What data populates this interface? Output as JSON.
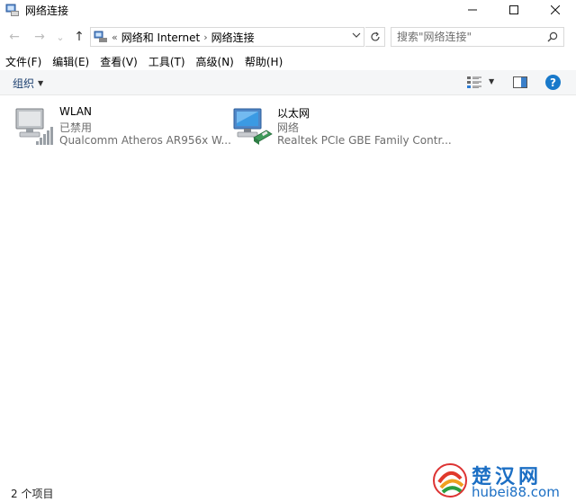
{
  "window": {
    "title": "网络连接"
  },
  "nav": {
    "back_glyph": "←",
    "forward_glyph": "→",
    "recent_glyph": "⌄",
    "up_glyph": "↑"
  },
  "address": {
    "overflow": "«",
    "crumbs": [
      "网络和 Internet",
      "网络连接"
    ],
    "separator": "›"
  },
  "search": {
    "placeholder": "搜索\"网络连接\""
  },
  "menu": {
    "items": [
      "文件(F)",
      "编辑(E)",
      "查看(V)",
      "工具(T)",
      "高级(N)",
      "帮助(H)"
    ]
  },
  "commandbar": {
    "organize_label": "组织",
    "help_label": "?"
  },
  "connections": [
    {
      "name": "WLAN",
      "status": "已禁用",
      "device": "Qualcomm Atheros AR956x W...",
      "icon": "wifi-adapter-icon"
    },
    {
      "name": "以太网",
      "status": "网络",
      "device": "Realtek PCIe GBE Family Contr...",
      "icon": "ethernet-adapter-icon"
    }
  ],
  "statusbar": {
    "item_count": "2 个项目"
  },
  "watermark": {
    "title": "楚汉网",
    "url": "hubei88.com"
  },
  "colors": {
    "accent": "#1979ca",
    "watermark_blue": "#1c6fc4",
    "muted_text": "#6d6d6d"
  }
}
